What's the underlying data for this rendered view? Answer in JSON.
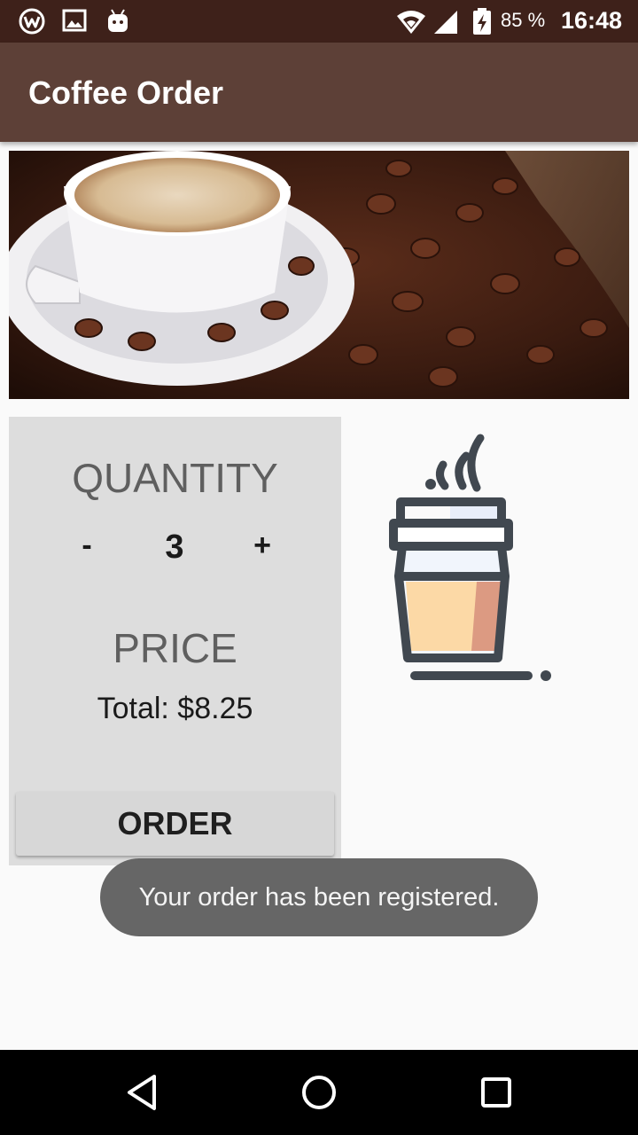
{
  "status_bar": {
    "battery_text": "85 %",
    "time": "16:48",
    "icons": [
      "app-w-icon",
      "gallery-icon",
      "android-icon",
      "wifi-icon",
      "signal-icon",
      "battery-charging-icon"
    ]
  },
  "app_bar": {
    "title": "Coffee Order",
    "color": "#5d4037"
  },
  "order_panel": {
    "quantity_heading": "QUANTITY",
    "minus_label": "-",
    "quantity": "3",
    "plus_label": "+",
    "price_heading": "PRICE",
    "total": "Total: $8.25",
    "order_label": "ORDER"
  },
  "toast": {
    "message": "Your order has been registered."
  },
  "nav_bar": {
    "icons": [
      "back-icon",
      "home-icon",
      "recents-icon"
    ]
  }
}
